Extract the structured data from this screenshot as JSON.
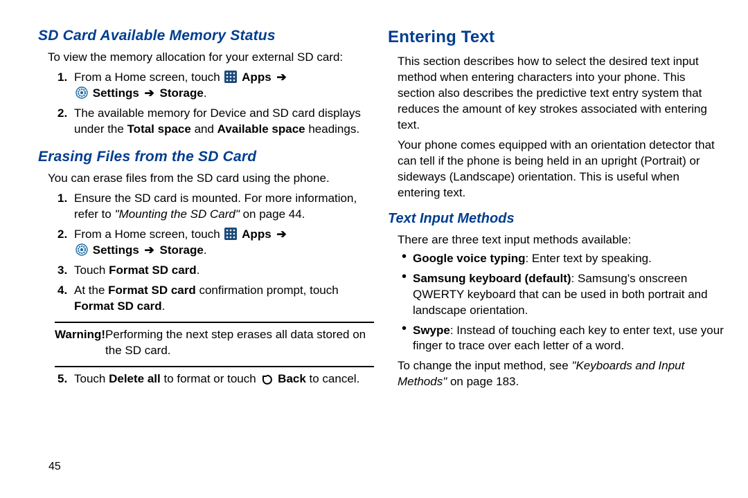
{
  "page_number": "45",
  "left": {
    "h1": "SD Card Available Memory Status",
    "p1": "To view the memory allocation for your external SD card:",
    "s1_a": "From a Home screen, touch ",
    "s1_apps": "Apps",
    "s1_settings": "Settings",
    "s1_storage": "Storage",
    "s2_a": "The available memory for Device and SD card displays under the ",
    "s2_b": "Total space",
    "s2_c": " and ",
    "s2_d": "Available space",
    "s2_e": " headings.",
    "h2": "Erasing Files from the SD Card",
    "p2": "You can erase files from the SD card using the phone.",
    "e1_a": "Ensure the SD card is mounted. For more information, refer to ",
    "e1_b": "\"Mounting the SD Card\"",
    "e1_c": " on page 44.",
    "e2_a": "From a Home screen, touch ",
    "e3_a": "Touch ",
    "e3_b": "Format SD card",
    "e3_c": ".",
    "e4_a": "At the ",
    "e4_b": "Format SD card",
    "e4_c": " confirmation prompt, touch ",
    "e4_d": "Format SD card",
    "e4_e": ".",
    "warn_label": "Warning!",
    "warn_text": "Performing the next step erases all data stored on the SD card.",
    "e5_a": "Touch ",
    "e5_b": "Delete all",
    "e5_c": " to format or touch ",
    "e5_back": "Back",
    "e5_d": " to cancel."
  },
  "right": {
    "h1": "Entering Text",
    "p1": "This section describes how to select the desired text input method when entering characters into your phone. This section also describes the predictive text entry system that reduces the amount of key strokes associated with entering text.",
    "p2": "Your phone comes equipped with an orientation detector that can tell if the phone is being held in an upright (Portrait) or sideways (Landscape) orientation. This is useful when entering text.",
    "h2": "Text Input Methods",
    "p3": "There are three text input methods available:",
    "b1_a": "Google voice typing",
    "b1_b": ": Enter text by speaking.",
    "b2_a": "Samsung keyboard (default)",
    "b2_b": ": Samsung's onscreen QWERTY keyboard that can be used in both portrait and landscape orientation.",
    "b3_a": "Swype",
    "b3_b": ": Instead of touching each key to enter text, use your finger to trace over each letter of a word.",
    "p4_a": "To change the input method, see ",
    "p4_b": "\"Keyboards and Input Methods\"",
    "p4_c": " on page 183."
  },
  "glyphs": {
    "arrow": "➔"
  }
}
